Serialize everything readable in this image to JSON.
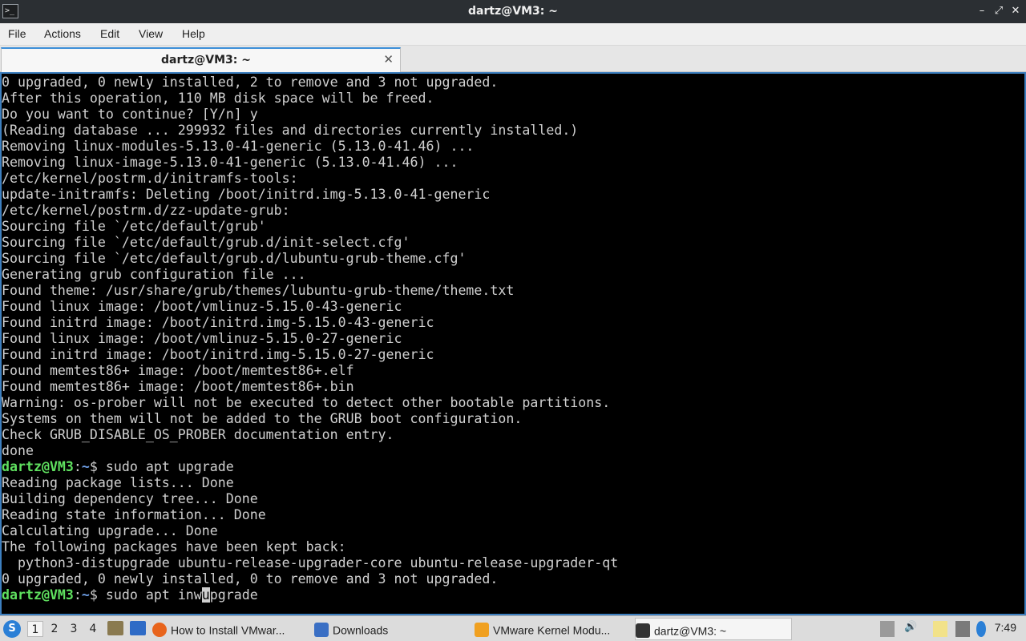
{
  "window": {
    "title": "dartz@VM3: ~",
    "app_icon": ">_",
    "controls": {
      "minimize": "–",
      "restore": "⤢",
      "close": "✕"
    }
  },
  "menu": [
    "File",
    "Actions",
    "Edit",
    "View",
    "Help"
  ],
  "tab": {
    "label": "dartz@VM3: ~",
    "close": "✕"
  },
  "terminal": {
    "prompt_user": "dartz@VM3",
    "prompt_sep": ":",
    "prompt_path": "~",
    "prompt_dollar": "$ ",
    "lines": [
      "0 upgraded, 0 newly installed, 2 to remove and 3 not upgraded.",
      "After this operation, 110 MB disk space will be freed.",
      "Do you want to continue? [Y/n] y",
      "(Reading database ... 299932 files and directories currently installed.)",
      "Removing linux-modules-5.13.0-41-generic (5.13.0-41.46) ...",
      "Removing linux-image-5.13.0-41-generic (5.13.0-41.46) ...",
      "/etc/kernel/postrm.d/initramfs-tools:",
      "update-initramfs: Deleting /boot/initrd.img-5.13.0-41-generic",
      "/etc/kernel/postrm.d/zz-update-grub:",
      "Sourcing file `/etc/default/grub'",
      "Sourcing file `/etc/default/grub.d/init-select.cfg'",
      "Sourcing file `/etc/default/grub.d/lubuntu-grub-theme.cfg'",
      "Generating grub configuration file ...",
      "Found theme: /usr/share/grub/themes/lubuntu-grub-theme/theme.txt",
      "Found linux image: /boot/vmlinuz-5.15.0-43-generic",
      "Found initrd image: /boot/initrd.img-5.15.0-43-generic",
      "Found linux image: /boot/vmlinuz-5.15.0-27-generic",
      "Found initrd image: /boot/initrd.img-5.15.0-27-generic",
      "Found memtest86+ image: /boot/memtest86+.elf",
      "Found memtest86+ image: /boot/memtest86+.bin",
      "Warning: os-prober will not be executed to detect other bootable partitions.",
      "Systems on them will not be added to the GRUB boot configuration.",
      "Check GRUB_DISABLE_OS_PROBER documentation entry.",
      "done"
    ],
    "cmd1": "sudo apt upgrade",
    "lines2": [
      "Reading package lists... Done",
      "Building dependency tree... Done",
      "Reading state information... Done",
      "Calculating upgrade... Done",
      "The following packages have been kept back:",
      "  python3-distupgrade ubuntu-release-upgrader-core ubuntu-release-upgrader-qt",
      "0 upgraded, 0 newly installed, 0 to remove and 3 not upgraded."
    ],
    "cmd2_before": "sudo apt inw",
    "cmd2_cursor": "u",
    "cmd2_after": "pgrade"
  },
  "taskbar": {
    "workspaces": [
      "1",
      "2",
      "3",
      "4"
    ],
    "active_workspace": "1",
    "tasks": [
      {
        "label": "How to Install VMwar...",
        "icon": "firefox-icon",
        "color": "#e8641c"
      },
      {
        "label": "Downloads",
        "icon": "folder-icon",
        "color": "#3a6fc4"
      },
      {
        "label": "VMware Kernel Modu...",
        "icon": "vmware-icon",
        "color": "#f0a020"
      },
      {
        "label": "dartz@VM3: ~",
        "icon": "terminal-icon",
        "color": "#333333"
      }
    ],
    "clock": "7:49",
    "colors": {
      "prompt_user": "#5fe05f",
      "prompt_path": "#6fa0e8",
      "accent": "#3d7fbf"
    }
  }
}
